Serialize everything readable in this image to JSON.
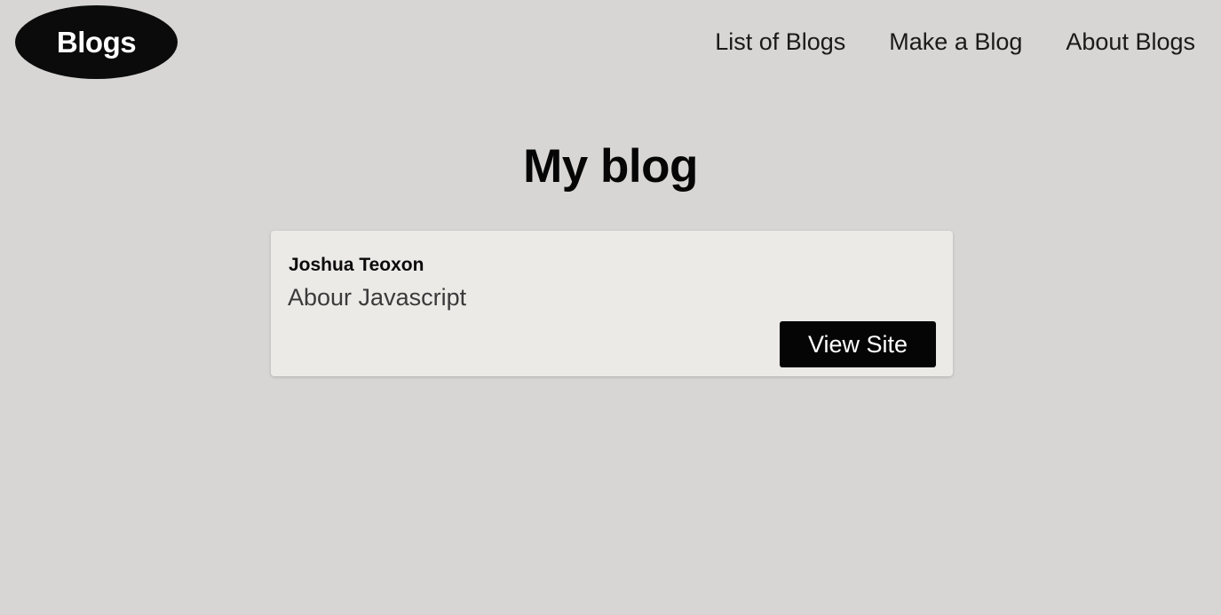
{
  "header": {
    "logo_text": "Blogs",
    "nav": {
      "list": "List of Blogs",
      "make": "Make a Blog",
      "about": "About Blogs"
    }
  },
  "main": {
    "title": "My blog",
    "blogs": [
      {
        "author": "Joshua Teoxon",
        "description": "Abour Javascript",
        "button_label": "View Site"
      }
    ]
  },
  "colors": {
    "background": "#d7d6d4",
    "card": "#ebeae7",
    "logo": "#0b0b0b",
    "button": "#050505"
  }
}
